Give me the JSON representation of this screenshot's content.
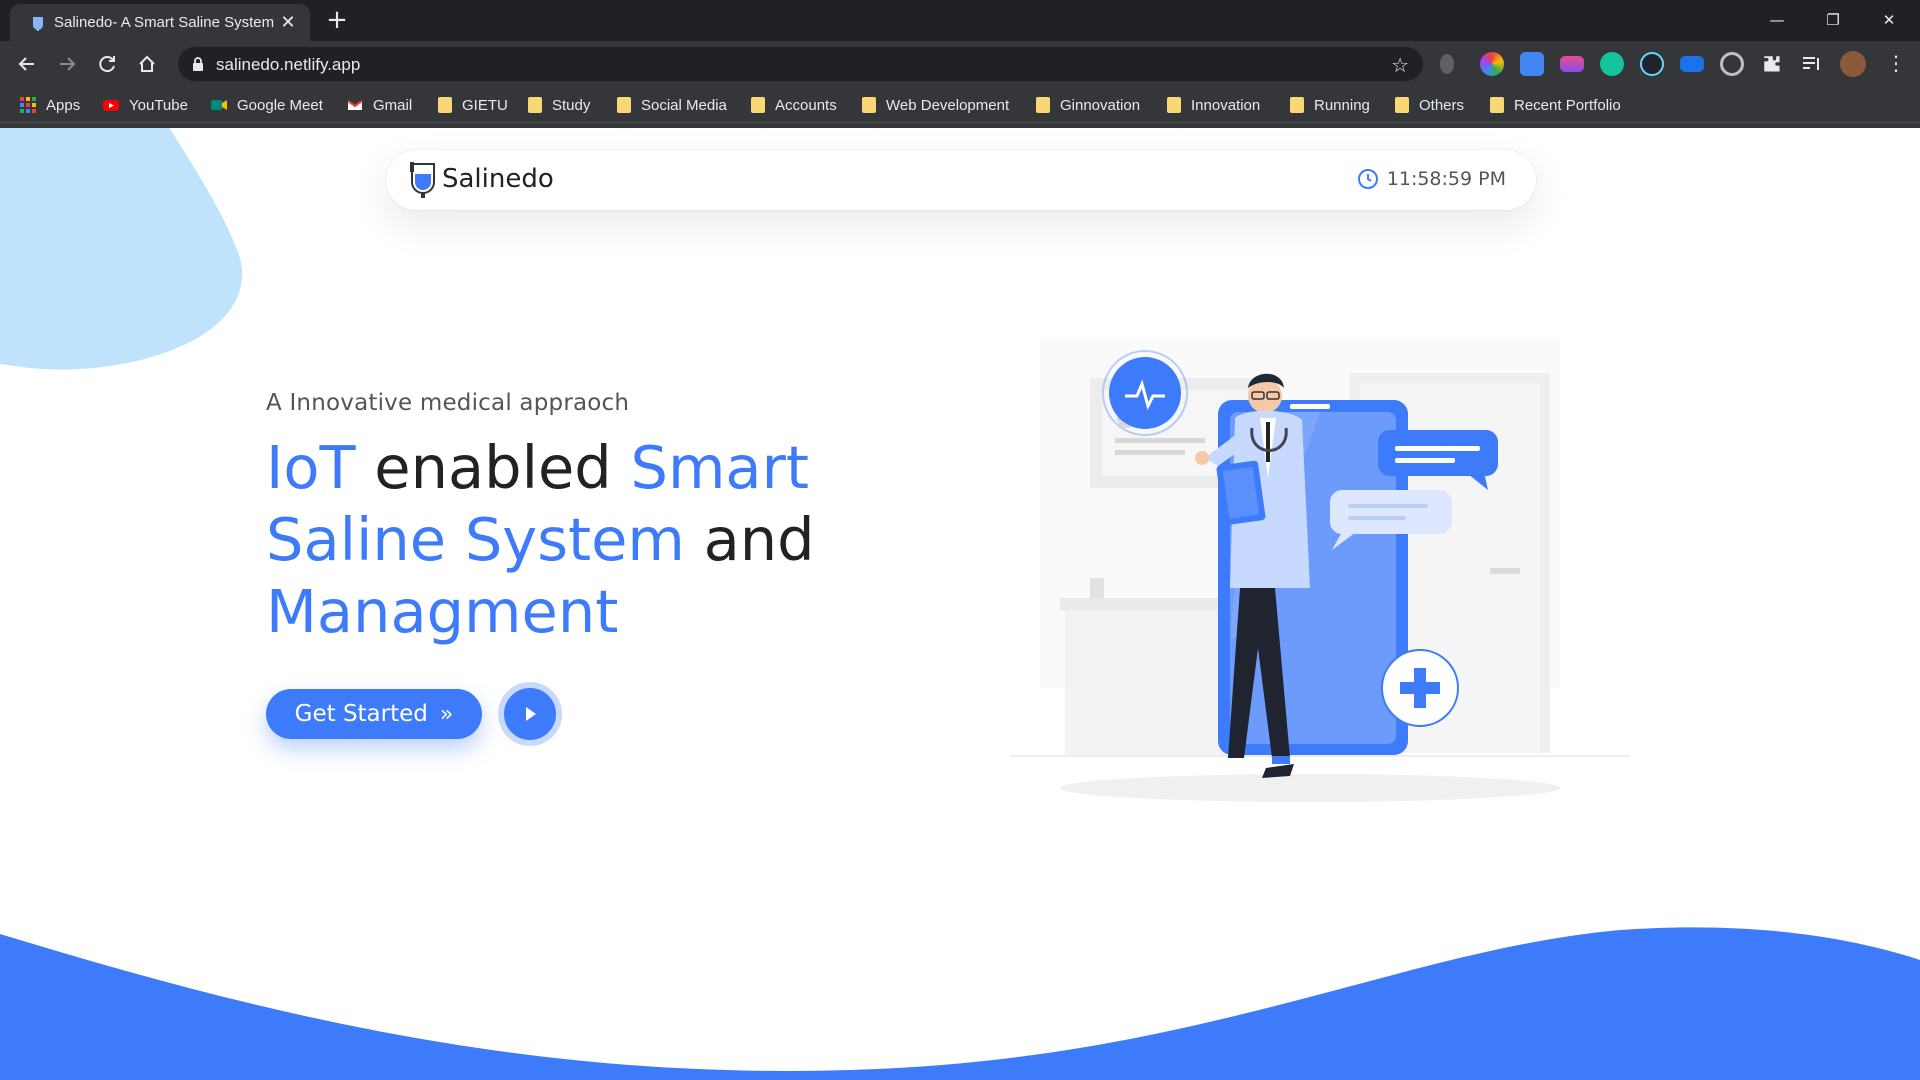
{
  "browser": {
    "tab_title": "Salinedo- A Smart Saline System",
    "url": "salinedo.netlify.app",
    "bookmarks": [
      {
        "label": "Apps",
        "icon": "apps-grid-icon"
      },
      {
        "label": "YouTube",
        "icon": "youtube-icon"
      },
      {
        "label": "Google Meet",
        "icon": "google-meet-icon"
      },
      {
        "label": "Gmail",
        "icon": "gmail-icon"
      },
      {
        "label": "GIETU",
        "icon": "folder-icon"
      },
      {
        "label": "Study",
        "icon": "folder-icon"
      },
      {
        "label": "Social Media",
        "icon": "folder-icon"
      },
      {
        "label": "Accounts",
        "icon": "folder-icon"
      },
      {
        "label": "Web Development",
        "icon": "folder-icon"
      },
      {
        "label": "Ginnovation",
        "icon": "folder-icon"
      },
      {
        "label": "Innovation",
        "icon": "folder-icon"
      },
      {
        "label": "Running",
        "icon": "folder-icon"
      },
      {
        "label": "Others",
        "icon": "folder-icon"
      },
      {
        "label": "Recent Portfolio",
        "icon": "folder-icon"
      }
    ]
  },
  "navbar": {
    "brand": "Salinedo",
    "clock": "11:58:59 PM"
  },
  "hero": {
    "kicker": "A Innovative medical appraoch",
    "headline_1": "IoT",
    "headline_2": " enabled ",
    "headline_3": "Smart Saline System",
    "headline_4": " and ",
    "headline_5": "Managment",
    "cta_label": "Get Started"
  },
  "colors": {
    "accent": "#3e7bfa",
    "blob": "#bfe3fb",
    "chrome_dark": "#202124",
    "chrome": "#35363a"
  }
}
